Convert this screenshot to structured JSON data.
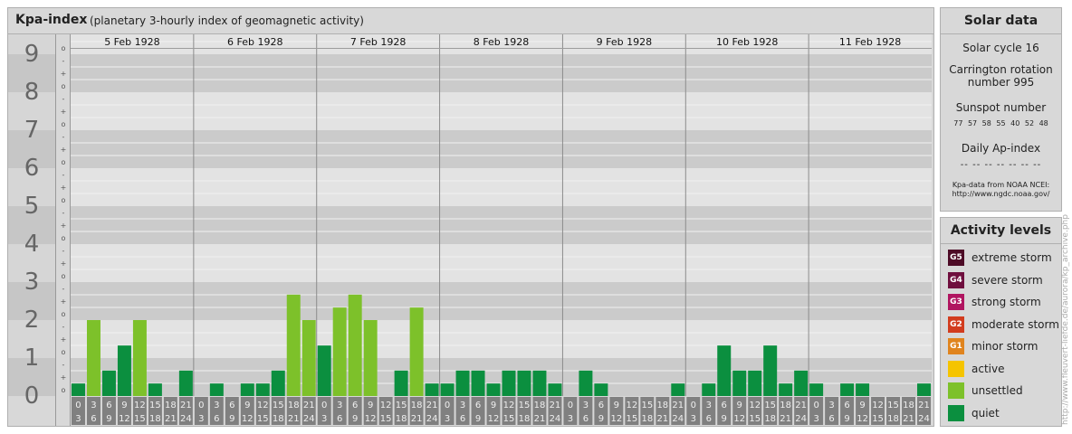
{
  "header": {
    "title": "Kpa-index",
    "subtitle": "(planetary 3-hourly index of geomagnetic activity)"
  },
  "solar": {
    "title": "Solar data",
    "solar_cycle": "Solar cycle 16",
    "carrington_line1": "Carrington rotation",
    "carrington_line2": "number 995",
    "sunspot_label": "Sunspot number",
    "sunspot_values": "77 57 58 55 40 52 48",
    "ap_label": "Daily Ap-index",
    "ap_values": "-- -- -- -- -- -- --",
    "credit_line1": "Kpa-data from NOAA NCEI:",
    "credit_line2": "http://www.ngdc.noaa.gov/"
  },
  "activity": {
    "title": "Activity levels",
    "levels": [
      {
        "code": "G5",
        "label": "extreme storm",
        "color": "#4d0b26"
      },
      {
        "code": "G4",
        "label": "severe storm",
        "color": "#6f0f3e"
      },
      {
        "code": "G3",
        "label": "strong storm",
        "color": "#b01560"
      },
      {
        "code": "G2",
        "label": "moderate storm",
        "color": "#d23c1e"
      },
      {
        "code": "G1",
        "label": "minor storm",
        "color": "#e0841e"
      },
      {
        "code": "",
        "label": "active",
        "color": "#f5c400"
      },
      {
        "code": "",
        "label": "unsettled",
        "color": "#7dc12a"
      },
      {
        "code": "",
        "label": "quiet",
        "color": "#0b8f3f"
      }
    ]
  },
  "watermark": "http://www.fleuvert-liefde.de/aurora/kp_archive.php",
  "chart_data": {
    "type": "bar",
    "title": "Kpa-index",
    "ylim": [
      0,
      9
    ],
    "y_ticks": [
      "0",
      "1",
      "2",
      "3",
      "4",
      "5",
      "6",
      "7",
      "8",
      "9"
    ],
    "sub_ticks": [
      "o",
      "+",
      "-"
    ],
    "days": [
      "5 Feb 1928",
      "6 Feb 1928",
      "7 Feb 1928",
      "8 Feb 1928",
      "9 Feb 1928",
      "10 Feb 1928",
      "11 Feb 1928"
    ],
    "interval_top": [
      "0",
      "3",
      "6",
      "9",
      "12",
      "15",
      "18",
      "21"
    ],
    "interval_bottom": [
      "3",
      "6",
      "9",
      "12",
      "15",
      "18",
      "21",
      "24"
    ],
    "colors": {
      "quiet": "#0b8f3f",
      "unsettled": "#7dc12a"
    },
    "values": [
      [
        0.33,
        2.0,
        0.67,
        1.33,
        2.0,
        0.33,
        0.0,
        0.67
      ],
      [
        0.0,
        0.33,
        0.0,
        0.33,
        0.33,
        0.67,
        2.67,
        2.0
      ],
      [
        1.33,
        2.33,
        2.67,
        2.0,
        0.0,
        0.67,
        2.33,
        0.33
      ],
      [
        0.33,
        0.67,
        0.67,
        0.33,
        0.67,
        0.67,
        0.67,
        0.33
      ],
      [
        0.0,
        0.67,
        0.33,
        0.0,
        0.0,
        0.0,
        0.0,
        0.33
      ],
      [
        0.0,
        0.33,
        1.33,
        0.67,
        0.67,
        1.33,
        0.33,
        0.67
      ],
      [
        0.33,
        0.0,
        0.33,
        0.33,
        0.0,
        0.0,
        0.0,
        0.33
      ]
    ]
  }
}
